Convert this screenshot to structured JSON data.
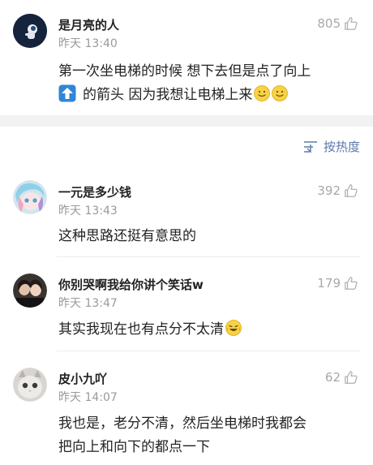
{
  "post": {
    "username": "是月亮的人",
    "time": "昨天 13:40",
    "likes": "805",
    "line1": "第一次坐电梯的时候  想下去但是点了向上",
    "line2": "的箭头  因为我想让电梯上来"
  },
  "sort": {
    "label": "按热度"
  },
  "comments": [
    {
      "username": "一元是多少钱",
      "time": "昨天 13:43",
      "likes": "392",
      "text": "这种思路还挺有意思的"
    },
    {
      "username": "你别哭啊我给你讲个笑话w",
      "time": "昨天 13:47",
      "likes": "179",
      "text": "其实我现在也有点分不太清"
    },
    {
      "username": "皮小九吖",
      "time": "昨天 14:07",
      "likes": "62",
      "line1": "我也是，老分不清，然后坐电梯时我都会",
      "line2": "把向上和向下的都点一下"
    }
  ],
  "colors": {
    "link_blue": "#5a7aa8",
    "muted_gray": "#9a9a9a",
    "band_gray": "#f2f2f2",
    "arrow_blue": "#2f86d6",
    "emoji_yellow": "#f7d244"
  },
  "icons": {
    "like": "thumbs-up-outline-icon",
    "sort": "sort-lines-icon",
    "up_arrow": "up-arrow-emoji-icon",
    "smile": "smiling-face-emoji-icon",
    "laugh_cry": "laughing-crying-emoji-icon"
  }
}
